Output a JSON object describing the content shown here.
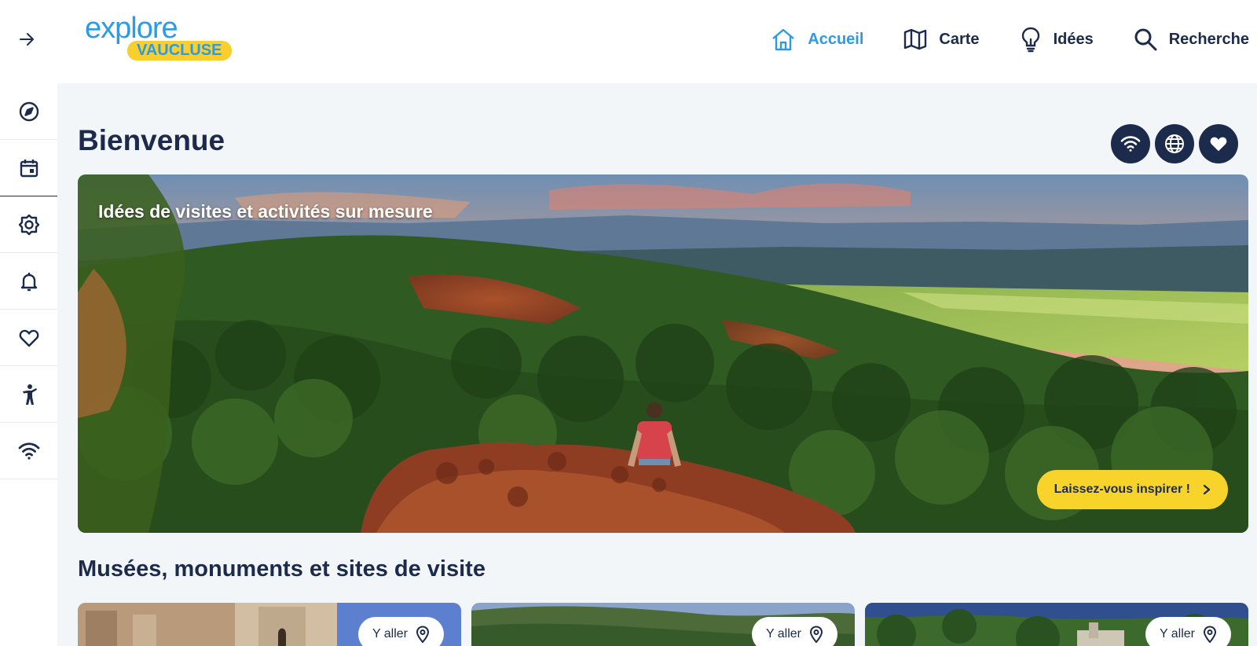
{
  "logo": {
    "line1": "explore",
    "line2": "VAUCLUSE"
  },
  "nav": [
    {
      "label": "Accueil",
      "icon": "home-icon",
      "active": true
    },
    {
      "label": "Carte",
      "icon": "map-icon",
      "active": false
    },
    {
      "label": "Idées",
      "icon": "lightbulb-icon",
      "active": false
    },
    {
      "label": "Recherche",
      "icon": "search-icon",
      "active": false
    }
  ],
  "sidebar": [
    {
      "icon": "compass-icon"
    },
    {
      "icon": "calendar-icon"
    },
    {
      "icon": "settings-icon"
    },
    {
      "icon": "bell-icon"
    },
    {
      "icon": "heart-icon"
    },
    {
      "icon": "accessibility-icon"
    },
    {
      "icon": "wifi-icon"
    }
  ],
  "page": {
    "title": "Bienvenue"
  },
  "actions": [
    "wifi-icon",
    "globe-icon",
    "heart-icon"
  ],
  "hero": {
    "caption": "Idées de visites et activités sur mesure",
    "cta": "Laissez-vous inspirer !"
  },
  "section": {
    "title": "Musées, monuments et sites de visite"
  },
  "cards": [
    {
      "go_label": "Y aller"
    },
    {
      "go_label": "Y aller"
    },
    {
      "go_label": "Y aller"
    }
  ],
  "colors": {
    "navy": "#1c2b4b",
    "accent_blue": "#2b9be6",
    "yellow": "#f8d42b",
    "background": "#f3f6f9"
  }
}
